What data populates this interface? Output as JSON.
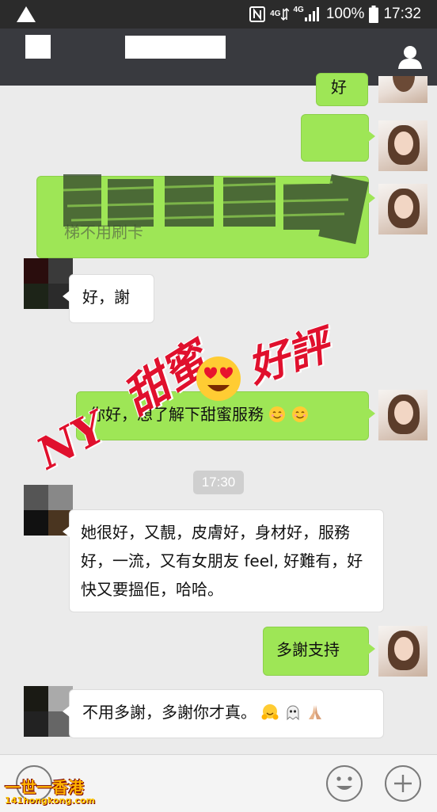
{
  "status_bar": {
    "battery_percent": "100%",
    "time": "17:32",
    "network": "4G"
  },
  "messages": [
    {
      "side": "right",
      "text": "好"
    },
    {
      "side": "right",
      "text": "梯不用刷卡"
    },
    {
      "side": "left",
      "text": "好，謝"
    },
    {
      "side": "right",
      "text": "你好，想了解下甜蜜服務"
    },
    {
      "side": "left",
      "text": "她很好，又靚，皮膚好，身材好，服務好，一流，又有女朋友 feel, 好難有，好快又要搵佢，哈哈。"
    },
    {
      "side": "right",
      "text": "多謝支持"
    },
    {
      "side": "left",
      "text": "不用多謝，多謝你才真。"
    }
  ],
  "timestamp": "17:30",
  "overlay": {
    "left_text": "NY",
    "middle_text": "甜蜜",
    "right_text": "好評"
  },
  "watermark": {
    "title": "一世一香港",
    "url": "141hongkong.com"
  },
  "icons": [
    "alert-icon",
    "nfc-icon",
    "signal-icon",
    "battery-icon",
    "user-icon",
    "emoji-button-icon",
    "plus-icon",
    "smile-emoji",
    "hug-emoji",
    "ghost-emoji",
    "pray-emoji",
    "heart-eyes-emoji"
  ],
  "colors": {
    "own_bubble": "#9ee656",
    "other_bubble": "#ffffff",
    "title_bar": "#393a3f",
    "overlay_red": "#e0102d"
  }
}
